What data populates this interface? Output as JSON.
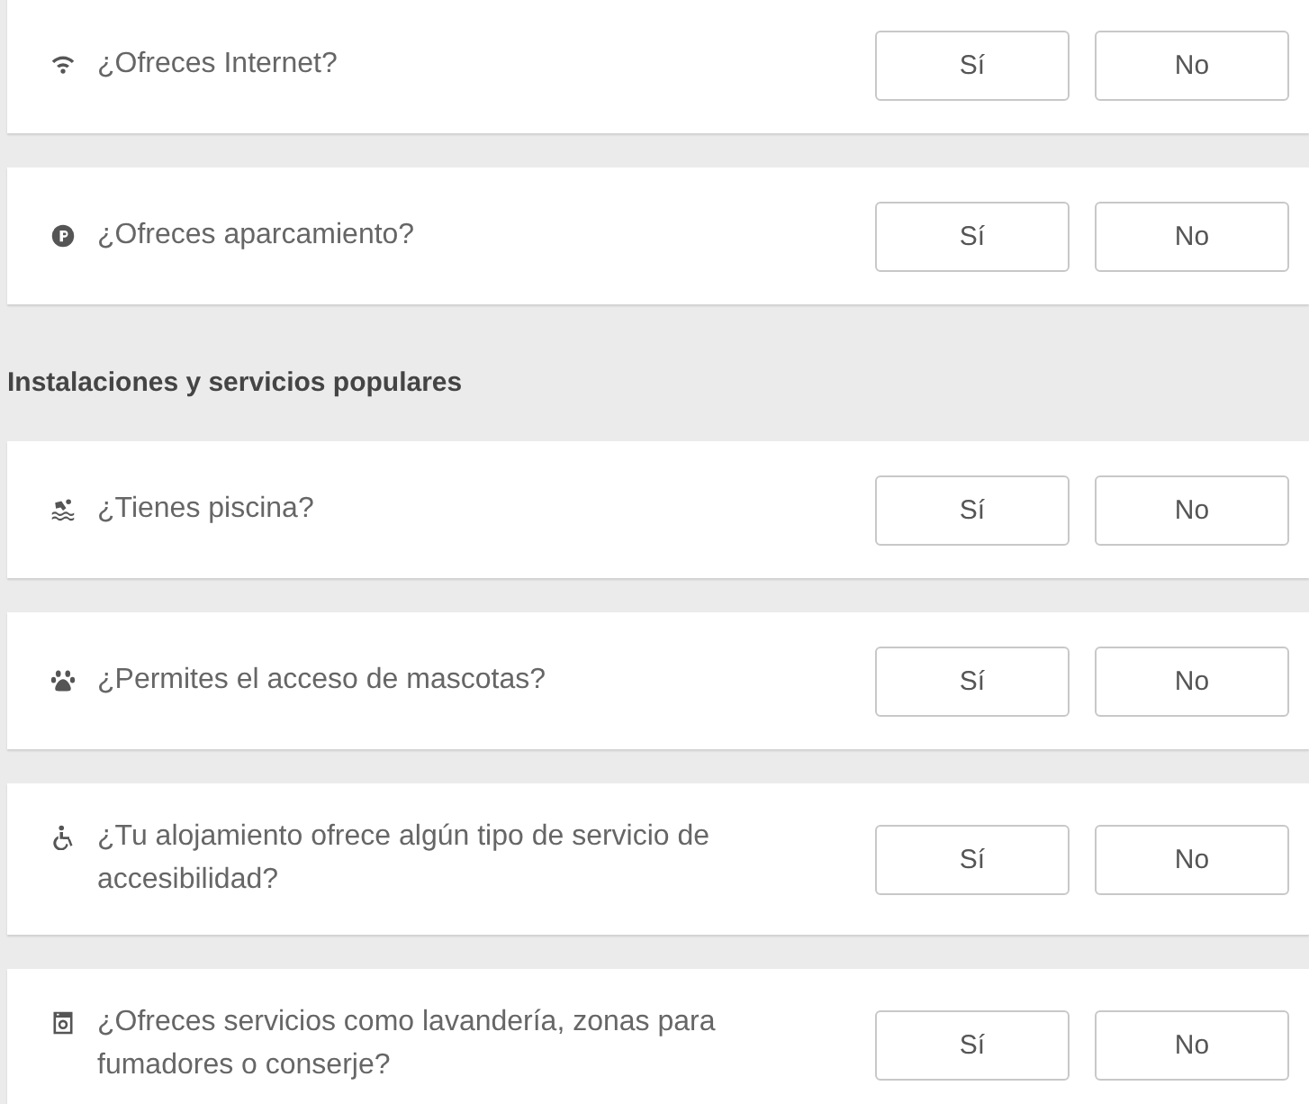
{
  "groups": [
    {
      "questions": [
        {
          "text": "¿Ofreces Internet?",
          "answers": [
            {
              "label": "Sí",
              "selected": false
            },
            {
              "label": "No",
              "selected": false
            }
          ]
        },
        {
          "text": "¿Ofreces aparcamiento?",
          "answers": [
            {
              "label": "Sí",
              "selected": false
            },
            {
              "label": "No",
              "selected": false
            }
          ]
        }
      ]
    },
    {
      "heading": "Instalaciones y servicios populares",
      "questions": [
        {
          "text": "¿Tienes piscina?",
          "answers": [
            {
              "label": "Sí",
              "selected": false
            },
            {
              "label": "No",
              "selected": false
            }
          ]
        },
        {
          "text": "¿Permites el acceso de mascotas?",
          "answers": [
            {
              "label": "Sí",
              "selected": false
            },
            {
              "label": "No",
              "selected": false
            }
          ]
        },
        {
          "text": "¿Tu alojamiento ofrece algún tipo de servicio de accesibilidad?",
          "answers": [
            {
              "label": "Sí",
              "selected": false
            },
            {
              "label": "No",
              "selected": false
            }
          ]
        },
        {
          "text": "¿Ofreces servicios como lavandería, zonas para fumadores o conserje?",
          "answers": [
            {
              "label": "Sí",
              "selected": false
            },
            {
              "label": "No",
              "selected": false
            }
          ]
        }
      ]
    }
  ]
}
